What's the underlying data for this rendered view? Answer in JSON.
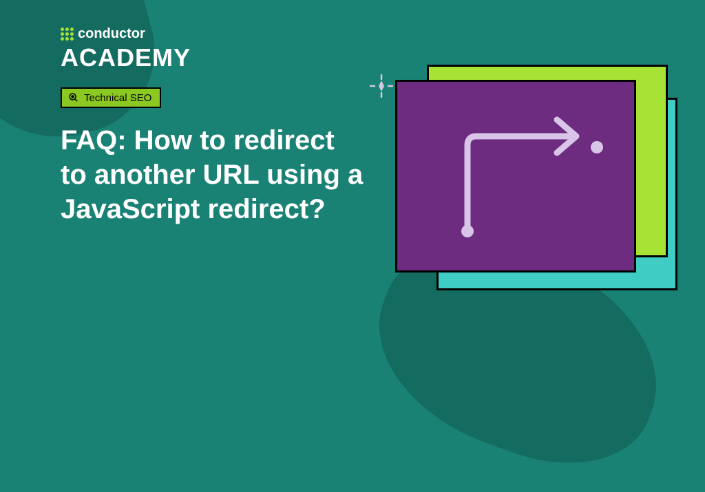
{
  "logo": {
    "brand": "conductor",
    "subbrand": "ACADEMY"
  },
  "tag": {
    "label": "Technical SEO"
  },
  "title": "FAQ: How to redirect to another URL using a JavaScript redirect?",
  "colors": {
    "background": "#1a8275",
    "accent_green": "#a8e234",
    "card_purple": "#6d2c7f",
    "card_cyan": "#3fccc5"
  }
}
